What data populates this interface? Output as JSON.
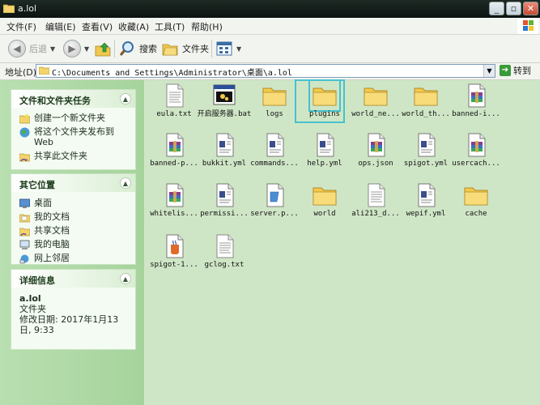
{
  "window": {
    "title": "a.lol"
  },
  "menu": [
    "文件(F)",
    "编辑(E)",
    "查看(V)",
    "收藏(A)",
    "工具(T)",
    "帮助(H)"
  ],
  "toolbar": {
    "back": "后退",
    "search": "搜索",
    "folders": "文件夹"
  },
  "address": {
    "label": "地址(D)",
    "path": "C:\\Documents and Settings\\Administrator\\桌面\\a.lol",
    "go": "转到"
  },
  "tasks": {
    "title": "文件和文件夹任务",
    "items": [
      "创建一个新文件夹",
      "将这个文件夹发布到 Web",
      "共享此文件夹"
    ]
  },
  "places": {
    "title": "其它位置",
    "items": [
      "桌面",
      "我的文档",
      "共享文档",
      "我的电脑",
      "网上邻居"
    ]
  },
  "details": {
    "title": "详细信息",
    "name": "a.lol",
    "type": "文件夹",
    "modified": "修改日期: 2017年1月13日, 9:33"
  },
  "files": [
    {
      "label": "eula.txt",
      "icon": "text-file-icon"
    },
    {
      "label": "开启服务器.bat",
      "icon": "batch-file-icon"
    },
    {
      "label": "logs",
      "icon": "folder-icon"
    },
    {
      "label": "plugins",
      "icon": "folder-icon",
      "selected": true
    },
    {
      "label": "world_ne...",
      "icon": "folder-icon"
    },
    {
      "label": "world_th...",
      "icon": "folder-icon"
    },
    {
      "label": "banned-i...",
      "icon": "archive-file-icon"
    },
    {
      "label": "banned-p...",
      "icon": "archive-file-icon"
    },
    {
      "label": "bukkit.yml",
      "icon": "document-file-icon"
    },
    {
      "label": "commands...",
      "icon": "document-file-icon"
    },
    {
      "label": "help.yml",
      "icon": "document-file-icon"
    },
    {
      "label": "ops.json",
      "icon": "archive-file-icon"
    },
    {
      "label": "spigot.yml",
      "icon": "document-file-icon"
    },
    {
      "label": "usercach...",
      "icon": "archive-file-icon"
    },
    {
      "label": "whitelis...",
      "icon": "archive-file-icon"
    },
    {
      "label": "permissi...",
      "icon": "document-file-icon"
    },
    {
      "label": "server.p...",
      "icon": "properties-file-icon"
    },
    {
      "label": "world",
      "icon": "folder-icon"
    },
    {
      "label": "ali213_d...",
      "icon": "text-file-icon"
    },
    {
      "label": "wepif.yml",
      "icon": "document-file-icon"
    },
    {
      "label": "cache",
      "icon": "folder-icon"
    },
    {
      "label": "spigot-1...",
      "icon": "jar-file-icon"
    },
    {
      "label": "gclog.txt",
      "icon": "text-file-icon"
    }
  ]
}
